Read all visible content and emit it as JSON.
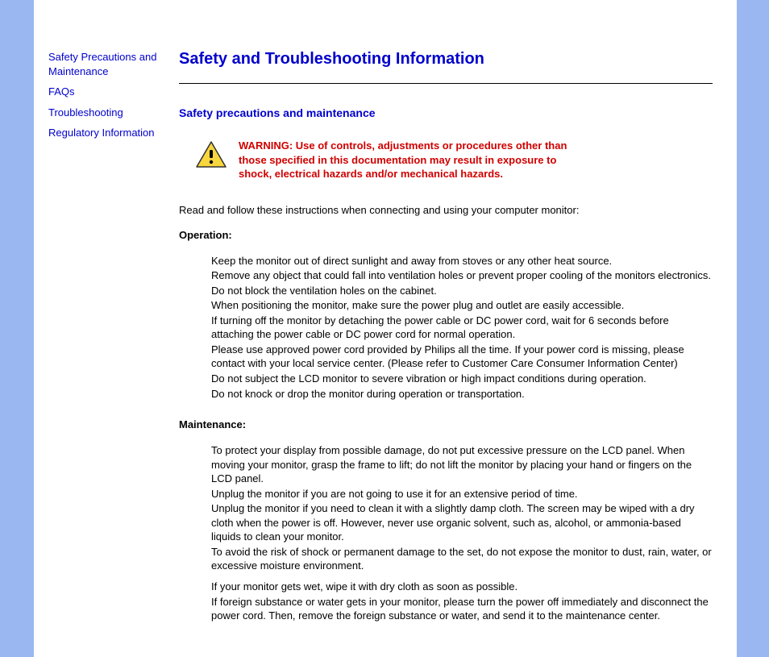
{
  "sidebar": {
    "items": [
      {
        "label": "Safety Precautions and Maintenance"
      },
      {
        "label": "FAQs"
      },
      {
        "label": "Troubleshooting"
      },
      {
        "label": "Regulatory Information"
      }
    ]
  },
  "main": {
    "title": "Safety and Troubleshooting Information",
    "section": "Safety precautions and maintenance",
    "warning": "WARNING: Use of controls, adjustments or procedures other than those specified in this documentation may result in exposure to shock, electrical hazards and/or mechanical hazards.",
    "intro": "Read and follow these instructions when connecting and using your computer monitor:",
    "operation": {
      "heading": "Operation:",
      "items": [
        "Keep the monitor out of direct sunlight and away from stoves or any other heat source.",
        "Remove any object that could fall into ventilation holes or prevent proper cooling of the monitors electronics.",
        "Do not block the ventilation holes on the cabinet.",
        "When positioning the monitor, make sure the power plug and outlet are easily accessible.",
        "If turning off the monitor by detaching the power cable or DC power cord, wait for 6 seconds before attaching the power cable or DC power cord for normal operation.",
        "Please use approved power cord provided by Philips all the time. If your power cord is missing, please contact with your local service center. (Please refer to Customer Care Consumer Information Center)",
        "Do not subject the LCD monitor to severe vibration or high impact conditions during operation.",
        "Do not knock or drop the monitor during operation or transportation."
      ]
    },
    "maintenance": {
      "heading": "Maintenance:",
      "items": [
        "To protect your display from possible damage, do not put excessive pressure on the LCD panel. When moving your monitor, grasp the frame to lift; do not lift the monitor by placing your hand or fingers on the LCD panel.",
        "Unplug the monitor if you are not going to use it for an extensive period of time.",
        "Unplug the monitor if you need to clean it with a slightly damp cloth. The screen may be wiped with a dry cloth when the power is off. However, never use organic solvent, such as, alcohol, or ammonia-based liquids to clean your monitor.",
        "To avoid the risk of shock or permanent damage to the set, do not expose the monitor to dust, rain, water, or excessive moisture environment."
      ],
      "items2": [
        "If your monitor gets wet, wipe it with dry cloth as soon as possible.",
        "If foreign substance or water gets in your monitor, please turn the power off immediately and disconnect the power cord. Then, remove the foreign substance or water, and send it to the maintenance center."
      ]
    }
  }
}
